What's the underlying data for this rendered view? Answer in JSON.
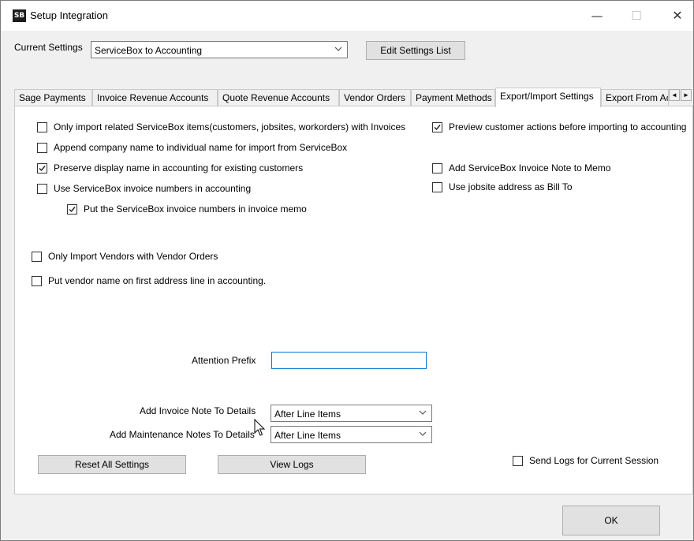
{
  "window": {
    "title": "Setup Integration",
    "icon_text": "SB",
    "controls": {
      "minimize": "—",
      "maximize": "☐",
      "close": "✕"
    }
  },
  "header": {
    "current_settings_label": "Current Settings",
    "current_settings_value": "ServiceBox to Accounting",
    "edit_settings_button": "Edit Settings List"
  },
  "tabs": [
    {
      "label": "Sage Payments",
      "active": false
    },
    {
      "label": "Invoice Revenue Accounts",
      "active": false
    },
    {
      "label": "Quote Revenue Accounts",
      "active": false
    },
    {
      "label": "Vendor Orders",
      "active": false
    },
    {
      "label": "Payment Methods",
      "active": false
    },
    {
      "label": "Export/Import Settings",
      "active": true
    },
    {
      "label": "Export From Ac",
      "active": false
    }
  ],
  "tab_scroll": {
    "left": "◄",
    "right": "►"
  },
  "left_checkboxes": [
    {
      "label": "Only import related ServiceBox items(customers, jobsites, workorders) with Invoices",
      "checked": false
    },
    {
      "label": "Append company name to individual name for import from ServiceBox",
      "checked": false
    },
    {
      "label": "Preserve display name in accounting for existing customers",
      "checked": true
    },
    {
      "label": "Use ServiceBox invoice numbers in accounting",
      "checked": false
    },
    {
      "label": "Put the ServiceBox invoice numbers in invoice memo",
      "checked": true
    }
  ],
  "right_checkboxes": [
    {
      "label": "Preview customer actions before importing to accounting",
      "checked": true
    },
    {
      "label": "Add ServiceBox Invoice Note to Memo",
      "checked": false
    },
    {
      "label": "Use jobsite address as Bill To",
      "checked": false
    }
  ],
  "vendor_checkboxes": [
    {
      "label": "Only Import Vendors with Vendor Orders",
      "checked": false
    },
    {
      "label": "Put vendor name on first address line in accounting.",
      "checked": false
    }
  ],
  "attention_prefix": {
    "label": "Attention Prefix",
    "value": ""
  },
  "invoice_note": {
    "label": "Add Invoice Note To Details",
    "value": "After Line Items"
  },
  "maintenance_notes": {
    "label": "Add Maintenance Notes To Details",
    "value": "After Line Items"
  },
  "buttons": {
    "reset": "Reset All Settings",
    "view_logs": "View Logs",
    "ok": "OK"
  },
  "send_logs": {
    "label": "Send Logs for Current Session",
    "checked": false
  }
}
